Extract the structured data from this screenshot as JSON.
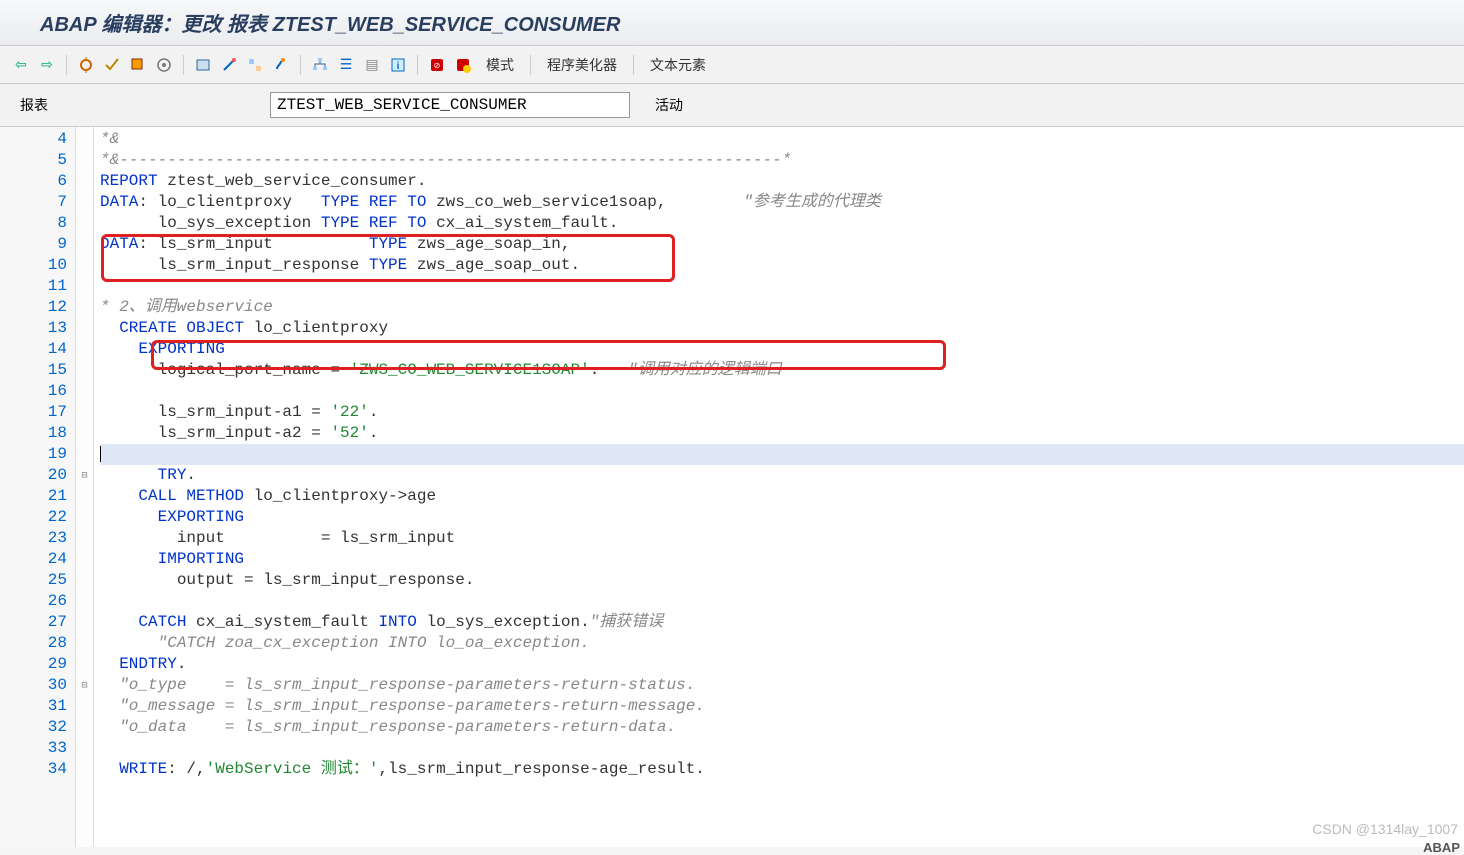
{
  "title": "ABAP 编辑器：更改 报表 ZTEST_WEB_SERVICE_CONSUMER",
  "toolbar": {
    "mode_label": "模式",
    "prettify_label": "程序美化器",
    "text_elem_label": "文本元素"
  },
  "input_row": {
    "label": "报表",
    "program_name": "ZTEST_WEB_SERVICE_CONSUMER",
    "status": "活动"
  },
  "gutter_start": 4,
  "gutter_end": 34,
  "code_lines": [
    {
      "n": 4,
      "seg": [
        [
          "cm-it",
          "*&"
        ]
      ]
    },
    {
      "n": 5,
      "seg": [
        [
          "cm-it",
          "*&---------------------------------------------------------------------*"
        ]
      ]
    },
    {
      "n": 6,
      "seg": [
        [
          "kw",
          "REPORT "
        ],
        [
          "",
          "ztest_web_service_consumer."
        ]
      ]
    },
    {
      "n": 7,
      "seg": [
        [
          "kw",
          "DATA"
        ],
        [
          "",
          ": lo_clientproxy   "
        ],
        [
          "kw",
          "TYPE REF TO "
        ],
        [
          "",
          "zws_co_web_service1soap,        "
        ],
        [
          "cm-it",
          "\"参考生成的代理类"
        ]
      ]
    },
    {
      "n": 8,
      "seg": [
        [
          "",
          "      lo_sys_exception "
        ],
        [
          "kw",
          "TYPE REF TO "
        ],
        [
          "",
          "cx_ai_system_fault."
        ]
      ]
    },
    {
      "n": 9,
      "seg": [
        [
          "kw",
          "DATA"
        ],
        [
          "",
          ": ls_srm_input          "
        ],
        [
          "kw",
          "TYPE "
        ],
        [
          "",
          "zws_age_soap_in,"
        ]
      ]
    },
    {
      "n": 10,
      "seg": [
        [
          "",
          "      ls_srm_input_response "
        ],
        [
          "kw",
          "TYPE "
        ],
        [
          "",
          "zws_age_soap_out."
        ]
      ]
    },
    {
      "n": 11,
      "seg": [
        [
          "",
          ""
        ]
      ]
    },
    {
      "n": 12,
      "seg": [
        [
          "cm-it",
          "* 2、调用webservice"
        ]
      ]
    },
    {
      "n": 13,
      "seg": [
        [
          "",
          "  "
        ],
        [
          "kw",
          "CREATE OBJECT "
        ],
        [
          "",
          "lo_clientproxy"
        ]
      ]
    },
    {
      "n": 14,
      "seg": [
        [
          "",
          "    "
        ],
        [
          "kw",
          "EXPORTING"
        ]
      ]
    },
    {
      "n": 15,
      "seg": [
        [
          "",
          "      logical_port_name = "
        ],
        [
          "str2",
          "'ZWS_CO_WEB_SERVICE1SOAP'"
        ],
        [
          "",
          ".   "
        ],
        [
          "cm-it",
          "\"调用对应的逻辑端口"
        ]
      ]
    },
    {
      "n": 16,
      "seg": [
        [
          "",
          ""
        ]
      ]
    },
    {
      "n": 17,
      "seg": [
        [
          "",
          "      ls_srm_input-a1 = "
        ],
        [
          "str2",
          "'22'"
        ],
        [
          "",
          "."
        ]
      ]
    },
    {
      "n": 18,
      "seg": [
        [
          "",
          "      ls_srm_input-a2 = "
        ],
        [
          "str2",
          "'52'"
        ],
        [
          "",
          "."
        ]
      ]
    },
    {
      "n": 19,
      "seg": [
        [
          "",
          ""
        ]
      ],
      "current": true
    },
    {
      "n": 20,
      "seg": [
        [
          "",
          "      "
        ],
        [
          "kw",
          "TRY"
        ],
        [
          "",
          "."
        ]
      ],
      "fold": "⊟"
    },
    {
      "n": 21,
      "seg": [
        [
          "",
          "    "
        ],
        [
          "kw",
          "CALL METHOD "
        ],
        [
          "",
          "lo_clientproxy->age"
        ]
      ]
    },
    {
      "n": 22,
      "seg": [
        [
          "",
          "      "
        ],
        [
          "kw",
          "EXPORTING"
        ]
      ]
    },
    {
      "n": 23,
      "seg": [
        [
          "",
          "        input          = ls_srm_input"
        ]
      ]
    },
    {
      "n": 24,
      "seg": [
        [
          "",
          "      "
        ],
        [
          "kw",
          "IMPORTING"
        ]
      ]
    },
    {
      "n": 25,
      "seg": [
        [
          "",
          "        output = ls_srm_input_response."
        ]
      ]
    },
    {
      "n": 26,
      "seg": [
        [
          "",
          ""
        ]
      ]
    },
    {
      "n": 27,
      "seg": [
        [
          "",
          "    "
        ],
        [
          "kw",
          "CATCH "
        ],
        [
          "",
          "cx_ai_system_fault "
        ],
        [
          "kw",
          "INTO "
        ],
        [
          "",
          "lo_sys_exception."
        ],
        [
          "cm-it",
          "\"捕获错误"
        ]
      ]
    },
    {
      "n": 28,
      "seg": [
        [
          "",
          "      "
        ],
        [
          "cm-it",
          "\"CATCH zoa_cx_exception INTO lo_oa_exception."
        ]
      ]
    },
    {
      "n": 29,
      "seg": [
        [
          "",
          "  "
        ],
        [
          "kw",
          "ENDTRY"
        ],
        [
          "",
          "."
        ]
      ]
    },
    {
      "n": 30,
      "seg": [
        [
          "",
          "  "
        ],
        [
          "cm-it",
          "\"o_type    = ls_srm_input_response-parameters-return-status."
        ]
      ],
      "fold": "⊟"
    },
    {
      "n": 31,
      "seg": [
        [
          "",
          "  "
        ],
        [
          "cm-it",
          "\"o_message = ls_srm_input_response-parameters-return-message."
        ]
      ]
    },
    {
      "n": 32,
      "seg": [
        [
          "",
          "  "
        ],
        [
          "cm-it",
          "\"o_data    = ls_srm_input_response-parameters-return-data."
        ]
      ]
    },
    {
      "n": 33,
      "seg": [
        [
          "",
          ""
        ]
      ]
    },
    {
      "n": 34,
      "seg": [
        [
          "",
          "  "
        ],
        [
          "kw",
          "WRITE"
        ],
        [
          "",
          ": /,"
        ],
        [
          "str2",
          "'WebService 测试：'"
        ],
        [
          "",
          ",ls_srm_input_response-age_result."
        ]
      ]
    }
  ],
  "watermark": "CSDN @1314lay_1007",
  "lang_tag": "ABAP"
}
